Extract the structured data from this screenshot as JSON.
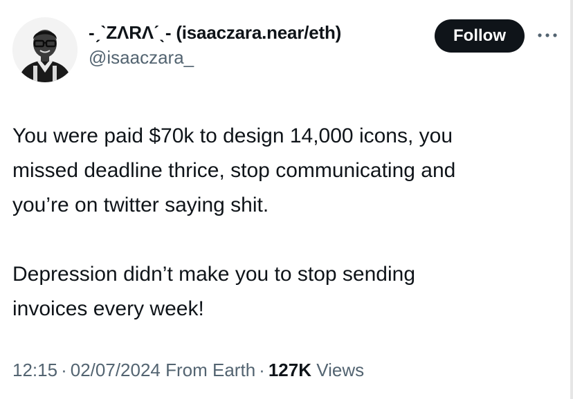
{
  "tweet": {
    "author": {
      "display_name": "-ˏˋZΛRΛˊˎ- (isaaczara.near/eth)",
      "handle": "@isaaczara_",
      "avatar_icon": "profile-photo"
    },
    "follow_label": "Follow",
    "more_icon": "more-horizontal-icon",
    "text": {
      "para1_line1": "You were paid $70k to design 14,000 icons, you",
      "para1_line2": "missed deadline thrice, stop communicating and",
      "para1_line3": "you’re on twitter saying shit.",
      "para2_line1": "Depression didn’t make you to stop sending",
      "para2_line2": "invoices every week!"
    },
    "meta": {
      "time": "12:15",
      "date": "02/07/2024",
      "source": "From Earth",
      "separator": "·",
      "views_count": "127K",
      "views_label": "Views"
    }
  },
  "colors": {
    "text_primary": "#0f1419",
    "text_secondary": "#536471",
    "follow_bg": "#0f1419",
    "follow_text": "#ffffff"
  }
}
